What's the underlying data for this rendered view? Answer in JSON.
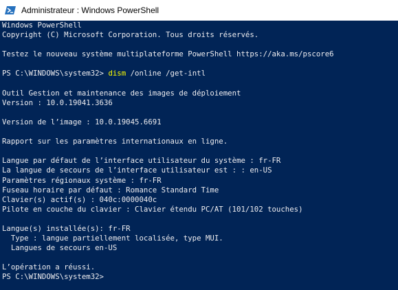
{
  "window": {
    "title": "Administrateur : Windows PowerShell",
    "icon": "powershell-icon",
    "colors": {
      "console_background": "#012456",
      "console_text": "#eeedf0",
      "command_highlight": "#ffff00"
    }
  },
  "console": {
    "lines": [
      {
        "text": "Windows PowerShell"
      },
      {
        "text": "Copyright (C) Microsoft Corporation. Tous droits réservés."
      },
      {
        "text": ""
      },
      {
        "text": "Testez le nouveau système multiplateforme PowerShell https://aka.ms/pscore6"
      },
      {
        "text": ""
      },
      {
        "prompt": "PS C:\\WINDOWS\\system32> ",
        "command": "dism",
        "args": " /online /get-intl"
      },
      {
        "text": ""
      },
      {
        "text": "Outil Gestion et maintenance des images de déploiement"
      },
      {
        "text": "Version : 10.0.19041.3636"
      },
      {
        "text": ""
      },
      {
        "text": "Version de l’image : 10.0.19045.6691"
      },
      {
        "text": ""
      },
      {
        "text": "Rapport sur les paramètres internationaux en ligne."
      },
      {
        "text": ""
      },
      {
        "text": "Langue par défaut de l’interface utilisateur du système : fr-FR"
      },
      {
        "text": "La langue de secours de l’interface utilisateur est : : en-US"
      },
      {
        "text": "Paramètres régionaux système : fr-FR"
      },
      {
        "text": "Fuseau horaire par défaut : Romance Standard Time"
      },
      {
        "text": "Clavier(s) actif(s) : 040c:0000040c"
      },
      {
        "text": "Pilote en couche du clavier : Clavier étendu PC/AT (101/102 touches)"
      },
      {
        "text": ""
      },
      {
        "text": "Langue(s) installée(s): fr-FR"
      },
      {
        "text": "  Type : langue partiellement localisée, type MUI."
      },
      {
        "text": "  Langues de secours en-US"
      },
      {
        "text": ""
      },
      {
        "text": "L’opération a réussi."
      },
      {
        "text": "PS C:\\WINDOWS\\system32>"
      }
    ]
  }
}
